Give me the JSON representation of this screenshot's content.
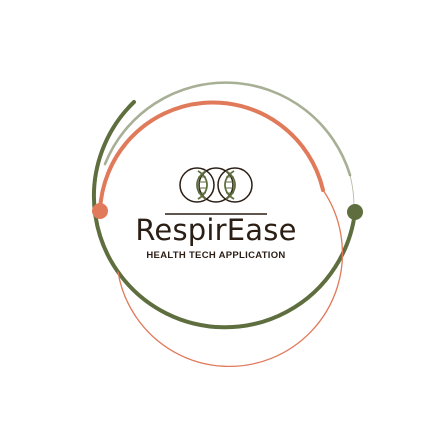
{
  "brand": {
    "name": "RespirEase",
    "tagline": "HEALTH TECH APPLICATION"
  },
  "colors": {
    "text": "#2b1e14",
    "green": "#5e6e3e",
    "orange": "#e07a5a",
    "background": "#ffffff"
  },
  "icons": {
    "emblem": "interlocking-lungs-icon"
  }
}
